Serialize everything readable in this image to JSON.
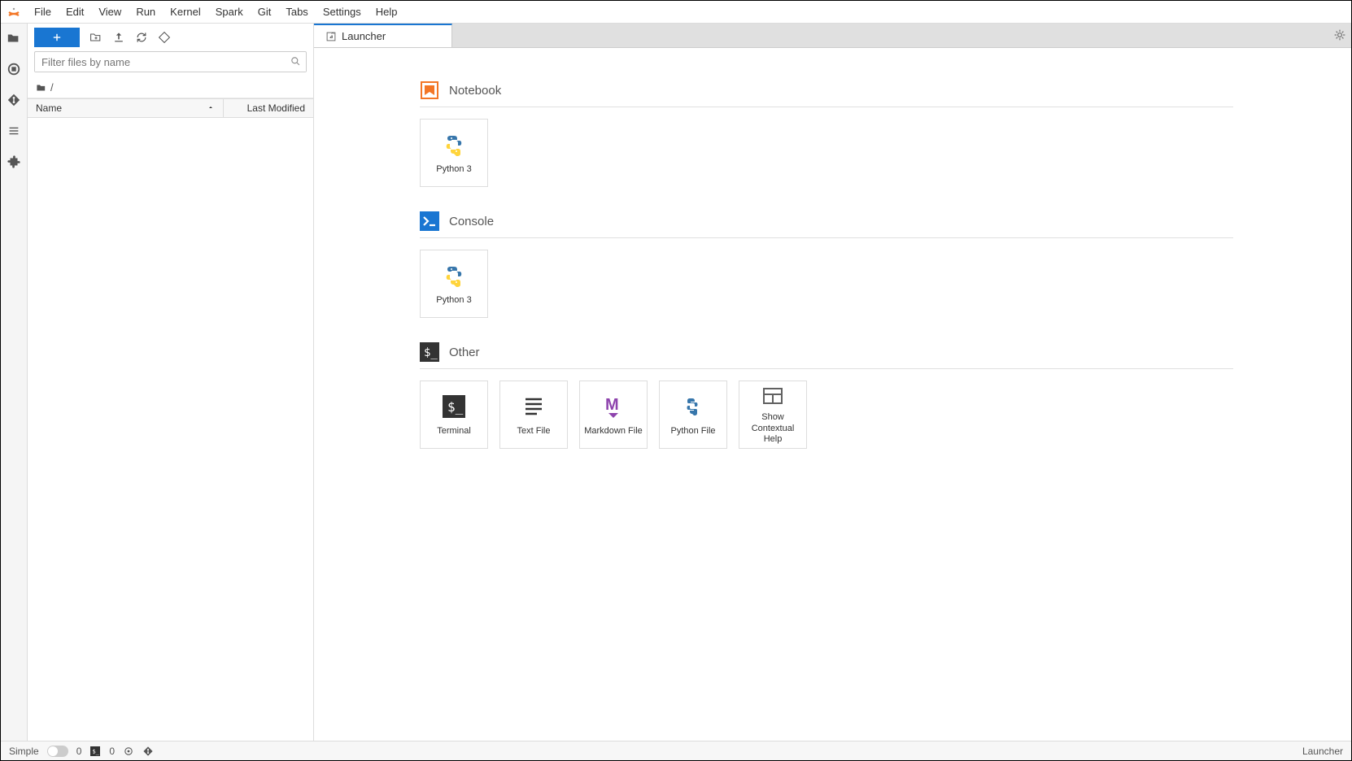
{
  "menubar": {
    "items": [
      "File",
      "Edit",
      "View",
      "Run",
      "Kernel",
      "Spark",
      "Git",
      "Tabs",
      "Settings",
      "Help"
    ]
  },
  "filebrowser": {
    "filter_placeholder": "Filter files by name",
    "breadcrumb_root": "/",
    "columns": {
      "name": "Name",
      "modified": "Last Modified"
    }
  },
  "tabs": [
    {
      "label": "Launcher"
    }
  ],
  "launcher": {
    "sections": [
      {
        "title": "Notebook",
        "icon": "notebook",
        "cards": [
          {
            "label": "Python 3",
            "icon": "python"
          }
        ]
      },
      {
        "title": "Console",
        "icon": "console",
        "cards": [
          {
            "label": "Python 3",
            "icon": "python"
          }
        ]
      },
      {
        "title": "Other",
        "icon": "terminal-badge",
        "cards": [
          {
            "label": "Terminal",
            "icon": "terminal"
          },
          {
            "label": "Text File",
            "icon": "textfile"
          },
          {
            "label": "Markdown File",
            "icon": "markdown"
          },
          {
            "label": "Python File",
            "icon": "pythonfile"
          },
          {
            "label": "Show Contextual Help",
            "icon": "contexthelp"
          }
        ]
      }
    ]
  },
  "statusbar": {
    "simple_label": "Simple",
    "count1": "0",
    "count2": "0",
    "mode": "Launcher"
  }
}
